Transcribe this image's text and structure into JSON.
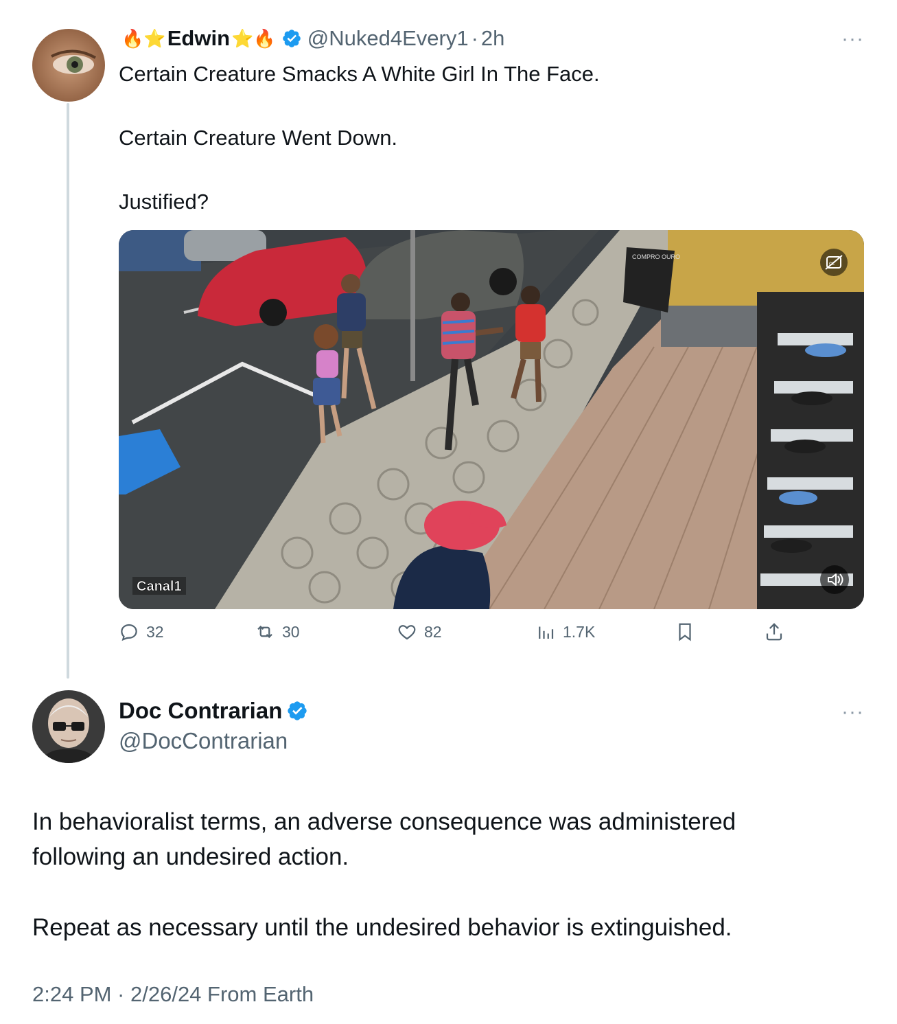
{
  "original_tweet": {
    "display_name": "Edwin",
    "name_emoji_left": "🔥⭐",
    "name_emoji_right": "⭐🔥",
    "handle": "@Nuked4Every1",
    "separator": "·",
    "time_ago": "2h",
    "text_lines": [
      "Certain Creature Smacks A White Girl In The Face.",
      "Certain Creature Went Down.",
      "Justified?"
    ],
    "media": {
      "watermark": "Canal1",
      "sign_text": "COMPRO OURO"
    },
    "actions": {
      "replies": "32",
      "reposts": "30",
      "likes": "82",
      "views": "1.7K"
    },
    "more_label": "···"
  },
  "reply_tweet": {
    "display_name": "Doc Contrarian",
    "handle": "@DocContrarian",
    "more_label": "···",
    "text_lines": [
      "In behavioralist terms, an adverse consequence was administered",
      "following an undesired action.",
      "Repeat as necessary until the undesired behavior is extinguished."
    ],
    "timestamp": "2:24 PM · 2/26/24 From Earth"
  },
  "colors": {
    "verified_blue": "#1d9bf0",
    "secondary_text": "#536471",
    "primary_text": "#0f1419",
    "thread_line": "#cfd9de"
  }
}
